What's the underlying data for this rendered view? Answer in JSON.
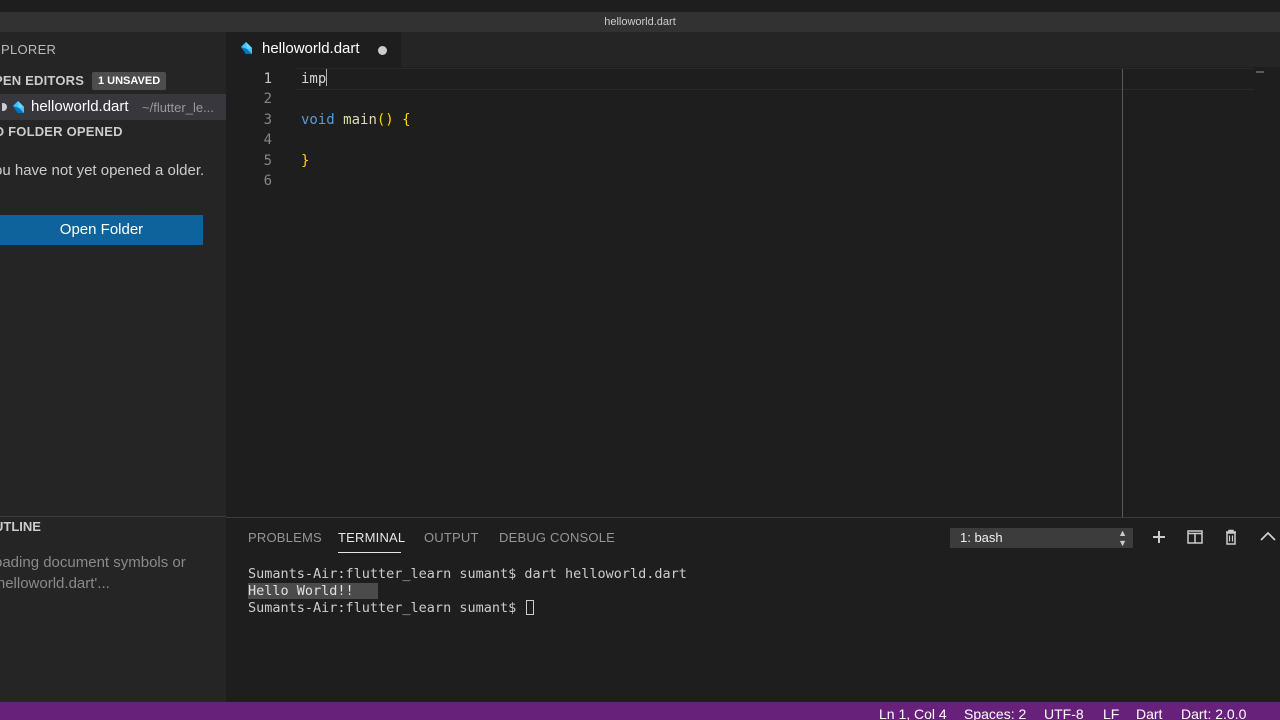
{
  "window": {
    "title": "helloworld.dart"
  },
  "sidebar": {
    "explorer_title": "XPLORER",
    "open_editors": {
      "header": "PEN EDITORS",
      "badge": "1 UNSAVED"
    },
    "open_file": {
      "name": "helloworld.dart",
      "path": "~/flutter_le..."
    },
    "no_folder": {
      "header": "O FOLDER OPENED",
      "message": "ou have not yet opened a older.",
      "button": "Open Folder"
    },
    "outline": {
      "header": "UTLINE",
      "message": "oading document symbols or 'helloworld.dart'..."
    }
  },
  "editor": {
    "tab": {
      "label": "helloworld.dart",
      "icon": "dart-icon",
      "unsaved": true
    },
    "lines": [
      {
        "num": "1",
        "text": "imp"
      },
      {
        "num": "2",
        "text": ""
      },
      {
        "num": "3",
        "kw": "void",
        "fn": "main",
        "rest": "() {"
      },
      {
        "num": "4",
        "text": ""
      },
      {
        "num": "5",
        "text": "}"
      },
      {
        "num": "6",
        "text": ""
      }
    ]
  },
  "panel": {
    "tabs": [
      "PROBLEMS",
      "TERMINAL",
      "OUTPUT",
      "DEBUG CONSOLE"
    ],
    "active_tab": "TERMINAL",
    "shell": "1: bash",
    "icons": [
      "plus-icon",
      "split-icon",
      "trash-icon",
      "chevron-up-icon"
    ],
    "terminal": {
      "line1": "Sumants-Air:flutter_learn sumant$ dart helloworld.dart",
      "line2": "Hello World!!",
      "line3": "Sumants-Air:flutter_learn sumant$ "
    }
  },
  "status": {
    "position": "Ln 1, Col 4",
    "spaces": "Spaces: 2",
    "encoding": "UTF-8",
    "eol": "LF",
    "language": "Dart",
    "sdk": "Dart: 2.0.0"
  },
  "colors": {
    "statusbar": "#68217a",
    "button": "#0e639c",
    "keyword": "#569cd6",
    "function": "#dcdcaa",
    "bracket": "#ffd700"
  }
}
